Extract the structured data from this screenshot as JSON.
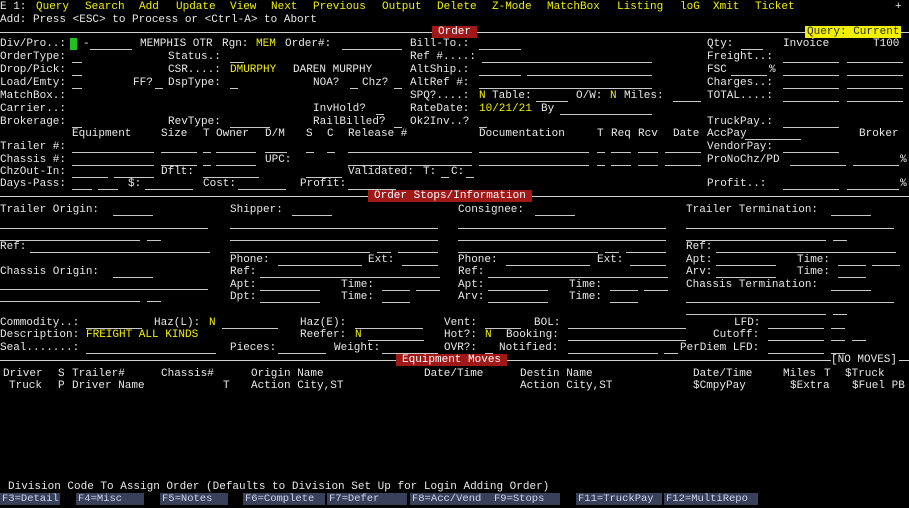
{
  "top": {
    "prefix": "E 1:",
    "menu": [
      "Query",
      "Search",
      "Add",
      "Update",
      "View",
      "Next",
      "Previous",
      "Output",
      "Delete",
      "Z-Mode",
      "MatchBox",
      "Listing",
      "loG",
      "Xmit",
      "Ticket"
    ],
    "plus": "+",
    "mode_line": "Add: Press <ESC> to Process or <Ctrl-A> to Abort",
    "query_badge": "Query: Current"
  },
  "sections": {
    "order": "Order",
    "stops": "Order Stops/Information",
    "moves": "Equipment Moves",
    "no_moves": "[NO MOVES]"
  },
  "order": {
    "divpro_label": "Div/Pro..:",
    "divpro_value": "-",
    "company": "MEMPHIS OTR",
    "rgn_label": "Rgn:",
    "rgn_value": "MEM",
    "order_no_label": "Order#:",
    "billto_label": "Bill-To.:",
    "qty_label": "Qty:",
    "invoice_label": "Invoice",
    "invoice_value": "T100",
    "ordertype_label": "OrderType:",
    "status_label": "Status.:",
    "ref_label": "Ref #....:",
    "freight_label": "Freight..:",
    "droppick_label": "Drop/Pick:",
    "csr_label": "CSR....:",
    "csr_value": "DMURPHY",
    "csr_name": "DAREN MURPHY",
    "altship_label": "AltShip.:",
    "fsc_label": "FSC",
    "fsc_pct": "%",
    "loademty_label": "Load/Emty:",
    "ff_label": "FF?",
    "dsptype_label": "DspType:",
    "noa_label": "NOA?",
    "chz_label": "Chz?",
    "altref_label": "AltRef #:",
    "charges_label": "Charges..:",
    "matchbox_label": "MatchBox.:",
    "spq_label": "SPQ?....:",
    "spq_value": "N",
    "table_label": "Table:",
    "ow_label": "O/W:",
    "ow_value": "N",
    "miles_label": "Miles:",
    "total_label": "TOTAL....:",
    "carrier_label": "Carrier..:",
    "invhold_label": "InvHold?",
    "ratedate_label": "RateDate:",
    "ratedate_value": "10/21/21",
    "by_label": "By",
    "brokerage_label": "Brokerage:",
    "revtype_label": "RevType:",
    "railbilled_label": "RailBilled?",
    "ok2inv_label": "Ok2Inv..?",
    "truckpay_label": "TruckPay.:",
    "hdr_equipment": "Equipment",
    "hdr_size": "Size",
    "hdr_t": "T",
    "hdr_owner": "Owner",
    "hdr_dm": "D/M",
    "hdr_s": "S",
    "hdr_c": "C",
    "hdr_release": "Release #",
    "hdr_documentation": "Documentation",
    "hdr_t2": "T",
    "hdr_req": "Req",
    "hdr_rcv": "Rcv",
    "hdr_date": "Date",
    "accpay_label": "AccPay",
    "broker_label": "Broker",
    "trailer_label": "Trailer #:",
    "vendorpay_label": "VendorPay:",
    "chassis_label": "Chassis #:",
    "upc_label": "UPC:",
    "pronochz_label": "ProNoChz/PD",
    "pronochz_pct": "%",
    "chzoutin_label": "ChzOut-In:",
    "dflt_label": "Dflt:",
    "validated_label": "Validated:",
    "validated_t": "T:",
    "validated_c": "C:",
    "dayspass_label": "Days-Pass:",
    "dollar_label": "$:",
    "cost_label": "Cost:",
    "profit_label": "Profit:",
    "profit2_label": "Profit..:",
    "profit2_pct": "%"
  },
  "stops": {
    "trailer_origin": "Trailer Origin:",
    "shipper": "Shipper:",
    "consignee": "Consignee:",
    "trailer_termination": "Trailer Termination:",
    "ref": "Ref:",
    "phone": "Phone:",
    "ext": "Ext:",
    "apt": "Apt:",
    "time": "Time:",
    "arv": "Arv:",
    "dpt": "Dpt:",
    "chassis_origin": "Chassis Origin:",
    "chassis_termination": "Chassis Termination:",
    "commodity": "Commodity..:",
    "hazl": "Haz(L):",
    "hazl_value": "N",
    "haze": "Haz(E):",
    "vent": "Vent:",
    "bol": "BOL:",
    "lfd": "LFD:",
    "description": "Description:",
    "description_value": "FREIGHT ALL KINDS",
    "reefer": "Reefer:",
    "reefer_value": "N",
    "hot": "Hot?:",
    "hot_value": "N",
    "booking": "Booking:",
    "cutoff": "Cutoff:",
    "seal": "Seal.......:",
    "pieces": "Pieces:",
    "weight": "Weight:",
    "ovr": "OVR?:",
    "notified": "Notified:",
    "perdiem": "PerDiem LFD:"
  },
  "moves": {
    "h1": [
      "Driver",
      "S",
      "Trailer#",
      "Chassis#",
      "Origin Name",
      "Date/Time",
      "Destin Name",
      "Date/Time",
      "Miles",
      "T",
      "$Truck"
    ],
    "h2": [
      "Truck",
      "P",
      "Driver Name",
      "T",
      "Action City,ST",
      "Action City,ST",
      "$CmpyPay",
      "$Extra",
      "$Fuel PB"
    ]
  },
  "status_text": "Division Code To Assign Order (Defaults to Division Set Up for Login Adding Order)",
  "fkeys": [
    "F3=Detail",
    "F4=Misc",
    "F5=Notes",
    "F6=Complete",
    "F7=Defer",
    "F8=Acc/Vend",
    "F9=Stops",
    "F11=TruckPay",
    "F12=MultiRepo"
  ]
}
